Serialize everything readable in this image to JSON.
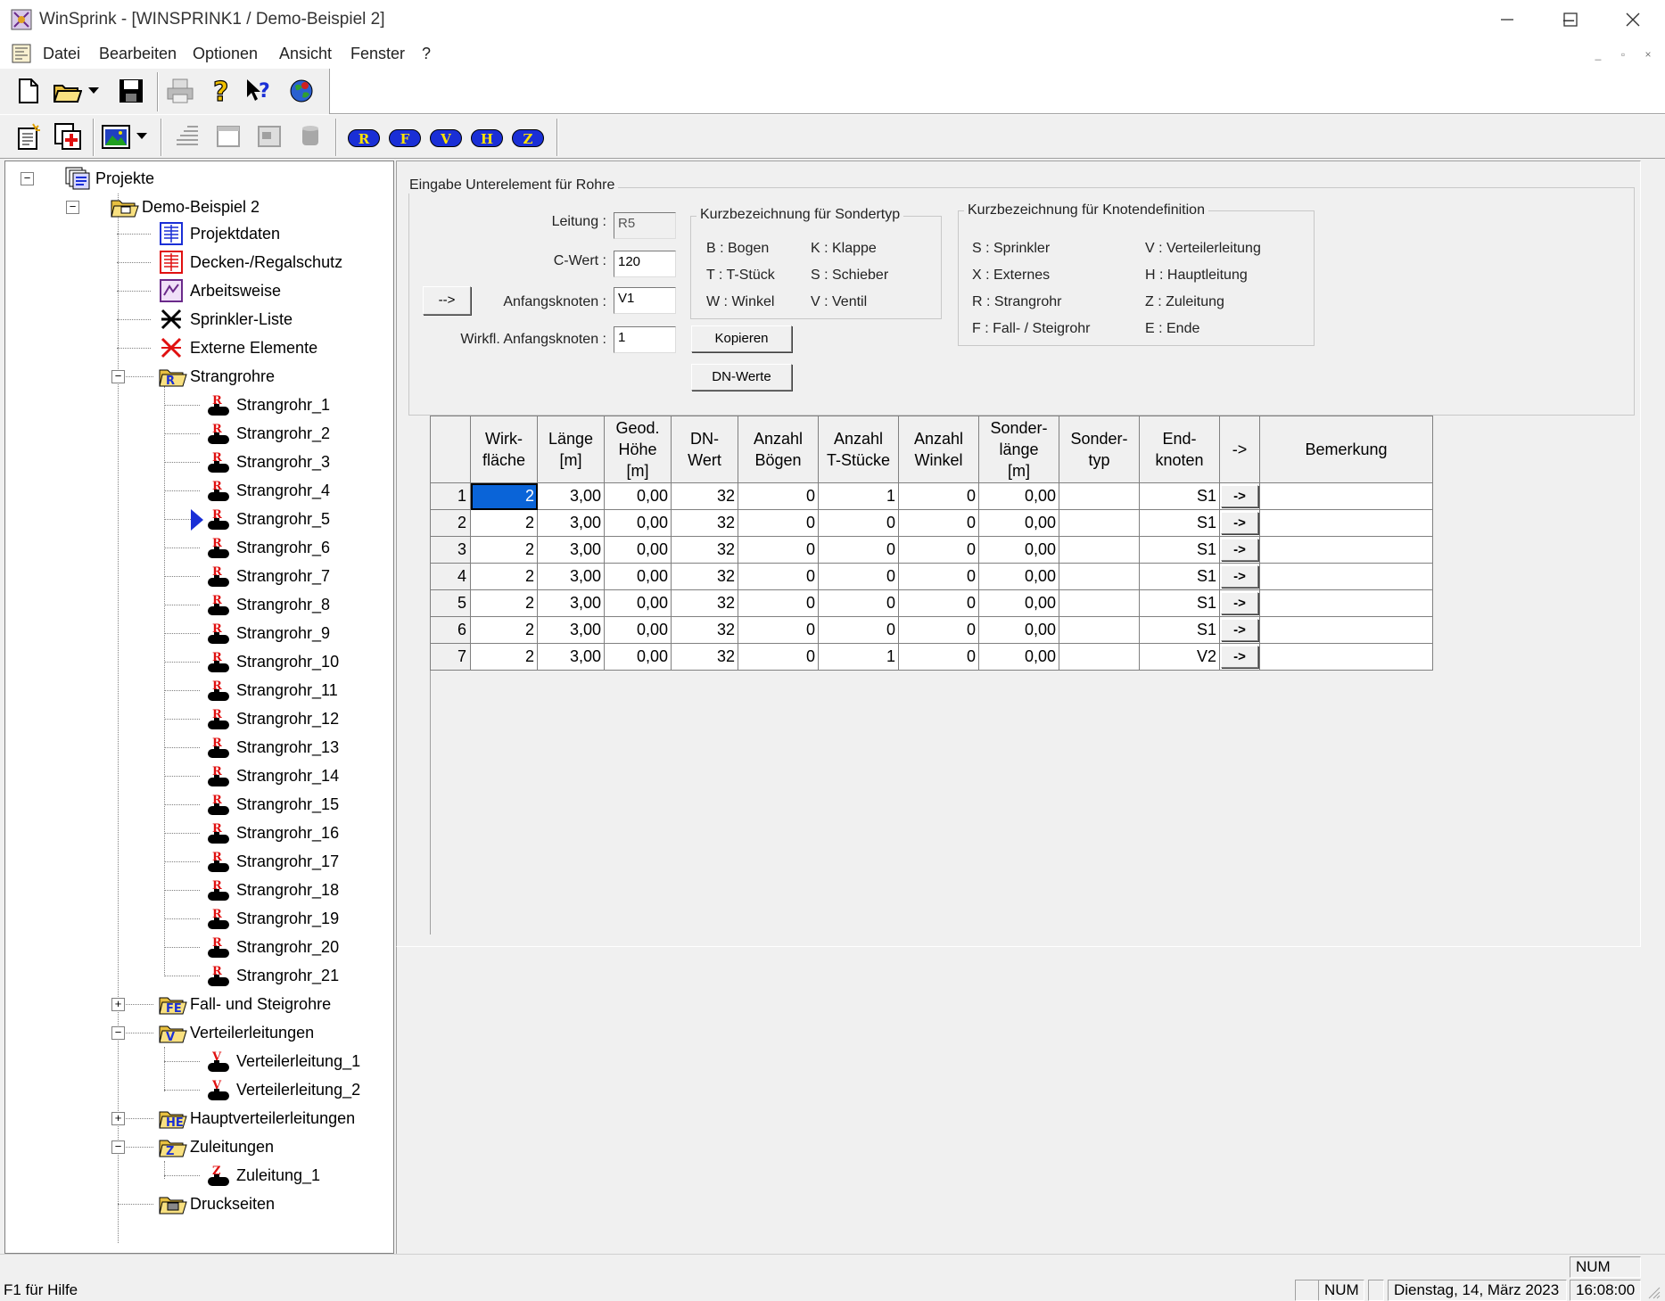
{
  "window": {
    "title": "WinSprink - [WINSPRINK1 / Demo-Beispiel 2]"
  },
  "menu": [
    "Datei",
    "Bearbeiten",
    "Optionen",
    "Ansicht",
    "Fenster",
    "?"
  ],
  "tree": {
    "root": "Projekte",
    "project": "Demo-Beispiel 2",
    "items": [
      "Projektdaten",
      "Decken-/Regalschutz",
      "Arbeitsweise",
      "Sprinkler-Liste",
      "Externe Elemente"
    ],
    "strangrohre_label": "Strangrohre",
    "strangrohre": [
      "Strangrohr_1",
      "Strangrohr_2",
      "Strangrohr_3",
      "Strangrohr_4",
      "Strangrohr_5",
      "Strangrohr_6",
      "Strangrohr_7",
      "Strangrohr_8",
      "Strangrohr_9",
      "Strangrohr_10",
      "Strangrohr_11",
      "Strangrohr_12",
      "Strangrohr_13",
      "Strangrohr_14",
      "Strangrohr_15",
      "Strangrohr_16",
      "Strangrohr_17",
      "Strangrohr_18",
      "Strangrohr_19",
      "Strangrohr_20",
      "Strangrohr_21"
    ],
    "fall": "Fall- und Steigrohre",
    "verteiler_label": "Verteilerleitungen",
    "verteiler": [
      "Verteilerleitung_1",
      "Verteilerleitung_2"
    ],
    "haupt": "Hauptverteilerleitungen",
    "zuleitungen_label": "Zuleitungen",
    "zuleitungen": [
      "Zuleitung_1"
    ],
    "druckseiten": "Druckseiten",
    "tree_icon_letters": {
      "strang": "R",
      "verteiler": "V",
      "zuleitung": "Z",
      "folder_r": "R",
      "folder_f": "FE",
      "folder_v": "V",
      "folder_h": "HE",
      "folder_z": "Z"
    }
  },
  "toolbar2_pills": [
    "R",
    "F",
    "V",
    "H",
    "Z"
  ],
  "form": {
    "group_title": "Eingabe Unterelement für Rohre",
    "arrow_button": "-->",
    "leitung_label": "Leitung :",
    "leitung_value": "R5",
    "cwert_label": "C-Wert :",
    "cwert_value": "120",
    "anfang_label": "Anfangsknoten :",
    "anfang_value": "V1",
    "wirkl_label": "Wirkfl. Anfangsknoten :",
    "wirkl_value": "1",
    "kopieren": "Kopieren",
    "dnwerte": "DN-Werte",
    "sondertyp_title": "Kurzbezeichnung für Sondertyp",
    "sondertyp": [
      "B : Bogen",
      "K : Klappe",
      "T : T-Stück",
      "S : Schieber",
      "W : Winkel",
      "V : Ventil"
    ],
    "knoten_title": "Kurzbezeichnung für Knotendefinition",
    "knoten": [
      "S : Sprinkler",
      "V : Verteilerleitung",
      "X : Externes",
      "H : Hauptleitung",
      "R : Strangrohr",
      "Z : Zuleitung",
      "F : Fall- / Steigrohr",
      "E : Ende"
    ]
  },
  "grid": {
    "headers": [
      [
        "Wirk-",
        "fläche"
      ],
      [
        "Länge",
        "[m]"
      ],
      [
        "Geod.",
        "Höhe",
        "[m]"
      ],
      [
        "DN-",
        "Wert"
      ],
      [
        "Anzahl",
        "Bögen"
      ],
      [
        "Anzahl",
        "T-Stücke"
      ],
      [
        "Anzahl",
        "Winkel"
      ],
      [
        "Sonder-",
        "länge",
        "[m]"
      ],
      [
        "Sonder-",
        "typ"
      ],
      [
        "End-",
        "knoten"
      ],
      [
        "->"
      ],
      [
        "Bemerkung"
      ]
    ],
    "row_button": "->",
    "rows": [
      {
        "n": "1",
        "wirk": "2",
        "laenge": "3,00",
        "hoehe": "0,00",
        "dn": "32",
        "boegen": "0",
        "tst": "1",
        "winkel": "0",
        "slaenge": "0,00",
        "styp": "",
        "end": "S1",
        "bem": ""
      },
      {
        "n": "2",
        "wirk": "2",
        "laenge": "3,00",
        "hoehe": "0,00",
        "dn": "32",
        "boegen": "0",
        "tst": "0",
        "winkel": "0",
        "slaenge": "0,00",
        "styp": "",
        "end": "S1",
        "bem": ""
      },
      {
        "n": "3",
        "wirk": "2",
        "laenge": "3,00",
        "hoehe": "0,00",
        "dn": "32",
        "boegen": "0",
        "tst": "0",
        "winkel": "0",
        "slaenge": "0,00",
        "styp": "",
        "end": "S1",
        "bem": ""
      },
      {
        "n": "4",
        "wirk": "2",
        "laenge": "3,00",
        "hoehe": "0,00",
        "dn": "32",
        "boegen": "0",
        "tst": "0",
        "winkel": "0",
        "slaenge": "0,00",
        "styp": "",
        "end": "S1",
        "bem": ""
      },
      {
        "n": "5",
        "wirk": "2",
        "laenge": "3,00",
        "hoehe": "0,00",
        "dn": "32",
        "boegen": "0",
        "tst": "0",
        "winkel": "0",
        "slaenge": "0,00",
        "styp": "",
        "end": "S1",
        "bem": ""
      },
      {
        "n": "6",
        "wirk": "2",
        "laenge": "3,00",
        "hoehe": "0,00",
        "dn": "32",
        "boegen": "0",
        "tst": "0",
        "winkel": "0",
        "slaenge": "0,00",
        "styp": "",
        "end": "S1",
        "bem": ""
      },
      {
        "n": "7",
        "wirk": "2",
        "laenge": "3,00",
        "hoehe": "0,00",
        "dn": "32",
        "boegen": "0",
        "tst": "1",
        "winkel": "0",
        "slaenge": "0,00",
        "styp": "",
        "end": "V2",
        "bem": ""
      }
    ]
  },
  "status": {
    "help": "F1 für Hilfe",
    "num_top": "NUM",
    "num": "NUM",
    "date": "Dienstag, 14, März 2023",
    "time": "16:08:00"
  },
  "colors": {
    "selection": "#0a64d8",
    "accent_blue": "#1a2fd6",
    "tree_red": "#e01010"
  }
}
